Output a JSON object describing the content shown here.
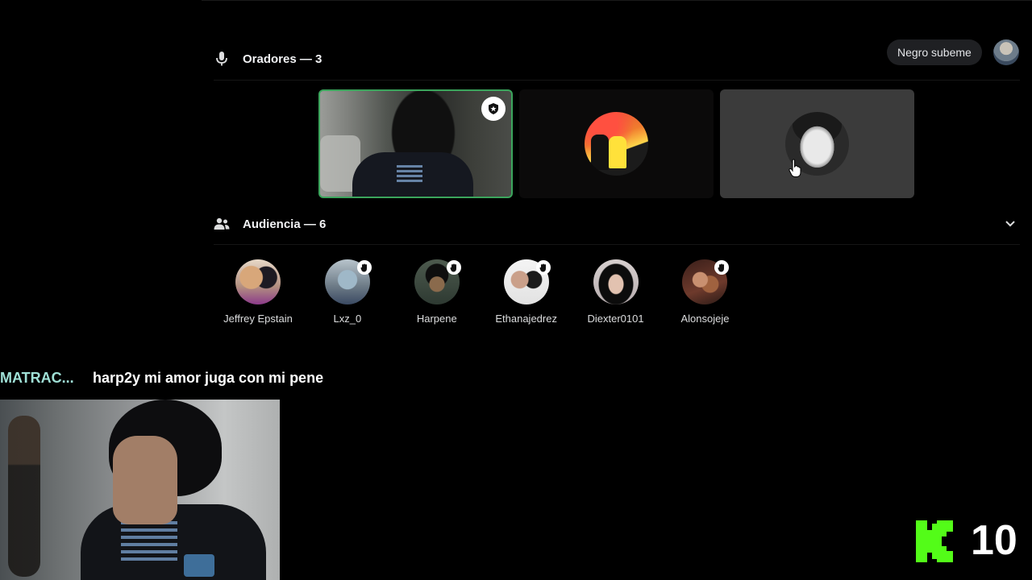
{
  "speakers_section": {
    "label": "Oradores — 3",
    "icon": "microphone-icon"
  },
  "user_chip": {
    "label": "Negro subeme"
  },
  "speakers": [
    {
      "id": "speaker-1",
      "speaking": true,
      "badge": "moderator-icon"
    },
    {
      "id": "speaker-2",
      "speaking": false
    },
    {
      "id": "speaker-3",
      "speaking": false
    }
  ],
  "audience_section": {
    "label": "Audiencia — 6",
    "icon": "people-icon",
    "collapse_icon": "chevron-down-icon"
  },
  "audience": [
    {
      "name": "Jeffrey Epstain",
      "hand_raised": false
    },
    {
      "name": "Lxz_0",
      "hand_raised": true
    },
    {
      "name": "Harpene",
      "hand_raised": true
    },
    {
      "name": "Ethanajedrez",
      "hand_raised": true
    },
    {
      "name": "Diexter0101",
      "hand_raised": false
    },
    {
      "name": "Alonsojeje",
      "hand_raised": true
    }
  ],
  "chat": {
    "username": "MATRAC...",
    "message": "harp2y mi amor juga con mi pene"
  },
  "kick": {
    "logo_letter": "K",
    "count": "10",
    "brand_color": "#53fc18"
  },
  "colors": {
    "speaking_border": "#3ba55c",
    "chat_name": "#9fe0d6",
    "background": "#000000"
  }
}
